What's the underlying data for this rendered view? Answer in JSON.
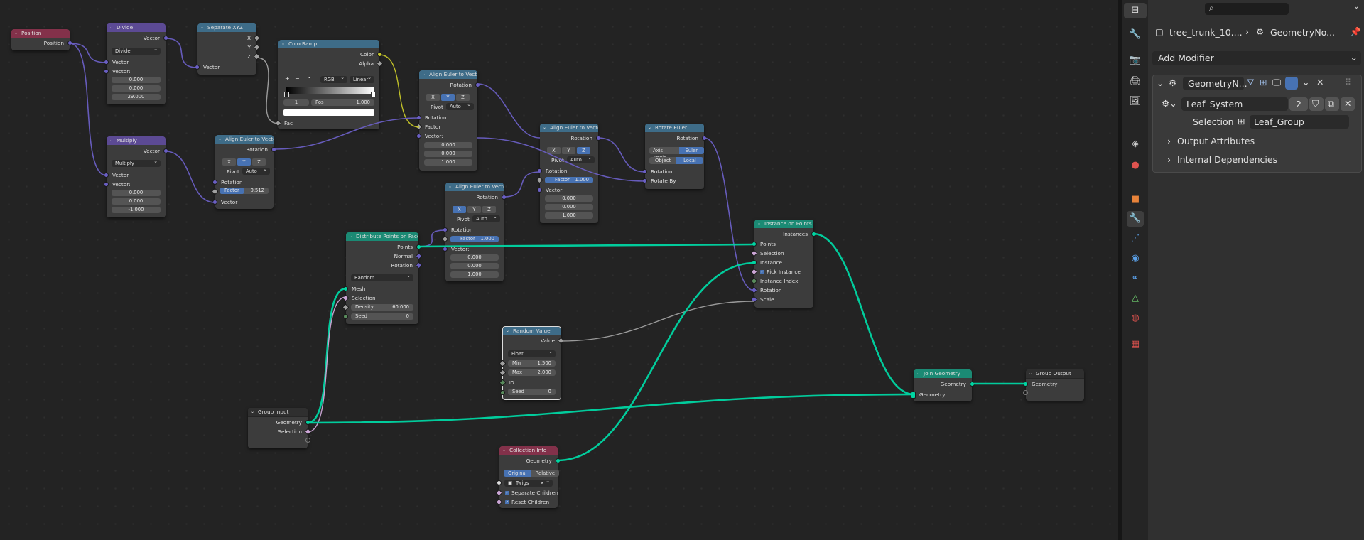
{
  "nodes": {
    "position": {
      "title": "Position",
      "out": "Position"
    },
    "divide": {
      "title": "Divide",
      "out": "Vector",
      "mode": "Divide",
      "in1": "Vector",
      "in2": "Vector:",
      "v1": "0.000",
      "v2": "0.000",
      "v3": "29.000"
    },
    "separate": {
      "title": "Separate XYZ",
      "x": "X",
      "y": "Y",
      "z": "Z",
      "in": "Vector"
    },
    "colorramp": {
      "title": "ColorRamp",
      "color": "Color",
      "alpha": "Alpha",
      "plus": "+",
      "minus": "−",
      "more": "⌄",
      "mode": "RGB",
      "interp": "Linear",
      "idx": "1",
      "pos_label": "Pos",
      "pos_val": "1.000",
      "fac": "Fac"
    },
    "multiply": {
      "title": "Multiply",
      "out": "Vector",
      "mode": "Multiply",
      "in1": "Vector",
      "in2": "Vector:",
      "v1": "0.000",
      "v2": "0.000",
      "v3": "-1.000"
    },
    "align1": {
      "title": "Align Euler to Vector",
      "rotation_out": "Rotation",
      "x": "X",
      "y": "Y",
      "z": "Z",
      "pivot_label": "Pivot",
      "pivot": "Auto",
      "rotation_in": "Rotation",
      "factor_label": "Factor",
      "factor": "0.512",
      "vector": "Vector"
    },
    "align2": {
      "title": "Align Euler to Vector",
      "rotation_out": "Rotation",
      "x": "X",
      "y": "Y",
      "z": "Z",
      "pivot_label": "Pivot",
      "pivot": "Auto",
      "rotation_in": "Rotation",
      "factor": "Factor",
      "vector": "Vector:",
      "v1": "0.000",
      "v2": "0.000",
      "v3": "1.000"
    },
    "align3": {
      "title": "Align Euler to Vector",
      "rotation_out": "Rotation",
      "x": "X",
      "y": "Y",
      "z": "Z",
      "pivot_label": "Pivot",
      "pivot": "Auto",
      "rotation_in": "Rotation",
      "factor_label": "Factor",
      "factor": "1.000",
      "vector": "Vector:",
      "v1": "0.000",
      "v2": "0.000",
      "v3": "1.000"
    },
    "align4": {
      "title": "Align Euler to Vector",
      "rotation_out": "Rotation",
      "x": "X",
      "y": "Y",
      "z": "Z",
      "pivot_label": "Pivot",
      "pivot": "Auto",
      "rotation_in": "Rotation",
      "factor_label": "Factor",
      "factor": "1.000",
      "vector": "Vector:",
      "v1": "0.000",
      "v2": "0.000",
      "v3": "1.000"
    },
    "rotate": {
      "title": "Rotate Euler",
      "rotation_out": "Rotation",
      "mode_a": "Axis Angle",
      "mode_b": "Euler",
      "space_a": "Object",
      "space_b": "Local",
      "rotation_in": "Rotation",
      "rotate_by": "Rotate By"
    },
    "distribute": {
      "title": "Distribute Points on Faces",
      "points": "Points",
      "normal": "Normal",
      "rotation": "Rotation",
      "mode": "Random",
      "mesh": "Mesh",
      "selection": "Selection",
      "density_label": "Density",
      "density": "60.000",
      "seed_label": "Seed",
      "seed": "0"
    },
    "instance": {
      "title": "Instance on Points",
      "instances": "Instances",
      "points": "Points",
      "selection": "Selection",
      "instance": "Instance",
      "pick": "Pick Instance",
      "index": "Instance Index",
      "rotation": "Rotation",
      "scale": "Scale"
    },
    "random": {
      "title": "Random Value",
      "value": "Value",
      "type": "Float",
      "min_label": "Min",
      "min": "1.500",
      "max_label": "Max",
      "max": "2.000",
      "id": "ID",
      "seed_label": "Seed",
      "seed": "0"
    },
    "join": {
      "title": "Join Geometry",
      "out": "Geometry",
      "in": "Geometry"
    },
    "output": {
      "title": "Group Output",
      "in": "Geometry"
    },
    "input": {
      "title": "Group Input",
      "geometry": "Geometry",
      "selection": "Selection"
    },
    "collection": {
      "title": "Collection Info",
      "out": "Geometry",
      "original": "Original",
      "relative": "Relative",
      "collection": "Twigs",
      "sep": "Separate Children",
      "reset": "Reset Children"
    }
  },
  "panel": {
    "breadcrumb_object": "tree_trunk_10....",
    "breadcrumb_sep": "›",
    "breadcrumb_modifier": "GeometryNo...",
    "add_modifier": "Add Modifier",
    "modifier_name": "GeometryN...",
    "nodegroup": "Leaf_System",
    "user_count": "2",
    "selection_label": "Selection",
    "selection_value": "Leaf_Group",
    "output_attributes": "Output Attributes",
    "internal_dependencies": "Internal Dependencies"
  },
  "colors": {
    "geometry_wire": "#00d6a3",
    "vector_wire": "#6a5fc4",
    "float_wire": "#a1a1a1",
    "color_wire": "#c7c729",
    "accent": "#4772b3"
  }
}
